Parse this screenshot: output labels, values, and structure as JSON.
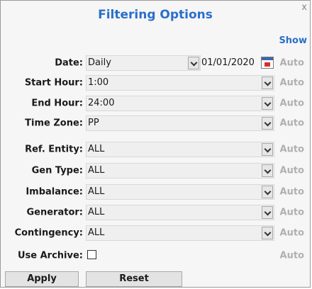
{
  "dialog": {
    "title": "Filtering Options",
    "close_label": "x",
    "show_label": "Show"
  },
  "fields": {
    "date": {
      "label": "Date:",
      "value": "Daily",
      "date_value": "01/01/2020",
      "auto": "Auto"
    },
    "start_hour": {
      "label": "Start Hour:",
      "value": "1:00",
      "auto": "Auto"
    },
    "end_hour": {
      "label": "End Hour:",
      "value": "24:00",
      "auto": "Auto"
    },
    "time_zone": {
      "label": "Time Zone:",
      "value": "PP",
      "auto": "Auto"
    },
    "ref_entity": {
      "label": "Ref. Entity:",
      "value": "ALL",
      "auto": "Auto"
    },
    "gen_type": {
      "label": "Gen Type:",
      "value": "ALL",
      "auto": "Auto"
    },
    "imbalance": {
      "label": "Imbalance:",
      "value": "ALL",
      "auto": "Auto"
    },
    "generator": {
      "label": "Generator:",
      "value": "ALL",
      "auto": "Auto"
    },
    "contingency": {
      "label": "Contingency:",
      "value": "ALL",
      "auto": "Auto"
    },
    "use_archive": {
      "label": "Use Archive:",
      "checked": false,
      "auto": "Auto"
    }
  },
  "buttons": {
    "apply": "Apply",
    "reset": "Reset"
  },
  "icons": {
    "calendar": "calendar-icon",
    "dropdown": "chevron-down-icon",
    "close": "close-icon"
  },
  "colors": {
    "title": "#2a6fc9",
    "auto_disabled": "#b0b0b0",
    "panel_bg": "#f6f6f6"
  }
}
